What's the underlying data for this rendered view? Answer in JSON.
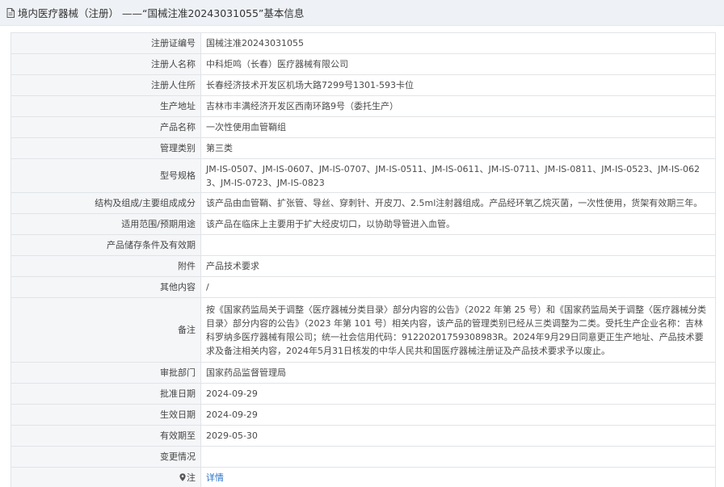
{
  "header": {
    "title": "境内医疗器械（注册） ——“国械注准20243031055”基本信息",
    "icon": "document-icon"
  },
  "rows": [
    {
      "label": "注册证编号",
      "value": "国械注准20243031055"
    },
    {
      "label": "注册人名称",
      "value": "中科炬鸣（长春）医疗器械有限公司"
    },
    {
      "label": "注册人住所",
      "value": "长春经济技术开发区机场大路7299号1301-593卡位"
    },
    {
      "label": "生产地址",
      "value": "吉林市丰满经济开发区西南环路9号（委托生产）"
    },
    {
      "label": "产品名称",
      "value": "一次性使用血管鞘组"
    },
    {
      "label": "管理类别",
      "value": "第三类"
    },
    {
      "label": "型号规格",
      "value": "JM-IS-0507、JM-IS-0607、JM-IS-0707、JM-IS-0511、JM-IS-0611、JM-IS-0711、JM-IS-0811、JM-IS-0523、JM-IS-0623、JM-IS-0723、JM-IS-0823"
    },
    {
      "label": "结构及组成/主要组成成分",
      "value": "该产品由血管鞘、扩张管、导丝、穿刺针、开皮刀、2.5ml注射器组成。产品经环氧乙烷灭菌，一次性使用，货架有效期三年。"
    },
    {
      "label": "适用范围/预期用途",
      "value": "该产品在临床上主要用于扩大经皮切口，以协助导管进入血管。"
    },
    {
      "label": "产品储存条件及有效期",
      "value": ""
    },
    {
      "label": "附件",
      "value": "产品技术要求"
    },
    {
      "label": "其他内容",
      "value": "/"
    },
    {
      "label": "备注",
      "value": "按《国家药监局关于调整〈医疗器械分类目录〉部分内容的公告》（2022 年第 25 号）和《国家药监局关于调整〈医疗器械分类目录〉部分内容的公告》（2023 年第 101 号）相关内容，该产品的管理类别已经从三类调整为二类。受托生产企业名称：吉林科罗纳多医疗器械有限公司；统一社会信用代码：91220201759308983R。2024年9月29日同意更正生产地址、产品技术要求及备注相关内容，2024年5月31日核发的中华人民共和国医疗器械注册证及产品技术要求予以废止。"
    },
    {
      "label": "审批部门",
      "value": "国家药品监督管理局"
    },
    {
      "label": "批准日期",
      "value": "2024-09-29"
    },
    {
      "label": "生效日期",
      "value": "2024-09-29"
    },
    {
      "label": "有效期至",
      "value": "2029-05-30"
    },
    {
      "label": "变更情况",
      "value": ""
    }
  ],
  "footer_row": {
    "label": "注",
    "label_icon": "map-pin-icon",
    "link": "详情",
    "link_color": "#2a72c7"
  }
}
